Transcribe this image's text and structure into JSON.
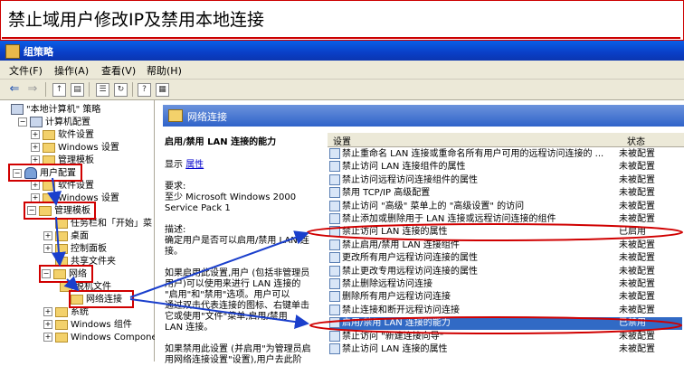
{
  "banner": {
    "title": "禁止域用户修改IP及禁用本地连接"
  },
  "window": {
    "title": "组策略"
  },
  "menu": [
    {
      "label": "文件(F)"
    },
    {
      "label": "操作(A)"
    },
    {
      "label": "查看(V)"
    },
    {
      "label": "帮助(H)"
    }
  ],
  "toolbar": {
    "icons": [
      "back-icon",
      "forward-icon",
      "up-folder-icon",
      "show-hide-tree-icon",
      "properties-icon",
      "refresh-icon",
      "help-icon",
      "view-icon"
    ]
  },
  "tree": {
    "root": "\"本地计算机\" 策略",
    "computer_config": "计算机配置",
    "software_settings_1": "软件设置",
    "windows_settings_1": "Windows 设置",
    "admin_templates_1": "管理模板",
    "user_config": "用户配置",
    "software_settings_2": "软件设置",
    "windows_settings_2": "Windows 设置",
    "admin_templates_2": "管理模板",
    "taskbar": "任务栏和「开始」菜",
    "desktop": "桌面",
    "control_panel": "控制面板",
    "shared_folders": "共享文件夹",
    "network": "网络",
    "offline_files": "脱机文件",
    "network_connections": "网络连接",
    "system": "系统",
    "windows_components": "Windows 组件",
    "windows_components_2": "Windows Components"
  },
  "detail": {
    "header": "网络连接",
    "policy_title": "启用/禁用 LAN 连接的能力",
    "show_label": "显示",
    "properties_link": "属性",
    "requirements_label": "要求:",
    "requirements_1": "至少 Microsoft Windows 2000",
    "requirements_2": "Service Pack 1",
    "description_label": "描述:",
    "description_1": "确定用户是否可以启用/禁用 LAN 连",
    "description_2": "接。",
    "body_lines": [
      "如果启用此设置,用户 (包括非管理员",
      "用户)可以使用来进行 LAN 连接的",
      "\"启用\"和\"禁用\"选项。用户可以",
      "通过双击代表连接的图标、右键单击",
      "它或使用\"文件\"菜单,启用/禁用",
      "LAN 连接。",
      "",
      "如果禁用此设置 (并启用\"为管理员启",
      "用网络连接设置\"设置),用户去此阶"
    ]
  },
  "list": {
    "col_setting": "设置",
    "col_state": "状态",
    "rows": [
      {
        "name": "禁止重命名 LAN 连接或重命名所有用户可用的远程访问连接的 ...",
        "state": "未被配置"
      },
      {
        "name": "禁止访问 LAN 连接组件的属性",
        "state": "未被配置"
      },
      {
        "name": "禁止访问远程访问连接组件的属性",
        "state": "未被配置"
      },
      {
        "name": "禁用 TCP/IP 高级配置",
        "state": "未被配置"
      },
      {
        "name": "禁止访问 \"高级\" 菜单上的 \"高级设置\" 的访问",
        "state": "未被配置"
      },
      {
        "name": "禁止添加或删除用于 LAN 连接或远程访问连接的组件",
        "state": "未被配置"
      },
      {
        "name": "禁止访问 LAN 连接的属性",
        "state": "已启用"
      },
      {
        "name": "禁止启用/禁用 LAN 连接组件",
        "state": "未被配置"
      },
      {
        "name": "更改所有用户远程访问连接的属性",
        "state": "未被配置"
      },
      {
        "name": "禁止更改专用远程访问连接的属性",
        "state": "未被配置"
      },
      {
        "name": "禁止删除远程访问连接",
        "state": "未被配置"
      },
      {
        "name": "删除所有用户远程访问连接",
        "state": "未被配置"
      },
      {
        "name": "禁止连接和断开远程访问连接",
        "state": "未被配置"
      },
      {
        "name": "启用/禁用 LAN 连接的能力",
        "state": "已禁用",
        "selected": true
      },
      {
        "name": "禁止访问 \"新建连接向导\"",
        "state": "未被配置"
      },
      {
        "name": "禁止访问 LAN 连接的属性",
        "state": "未被配置"
      }
    ]
  },
  "colors": {
    "annotation": "#d00000",
    "arrow": "#1a3fcc",
    "selection": "#316ac5"
  }
}
